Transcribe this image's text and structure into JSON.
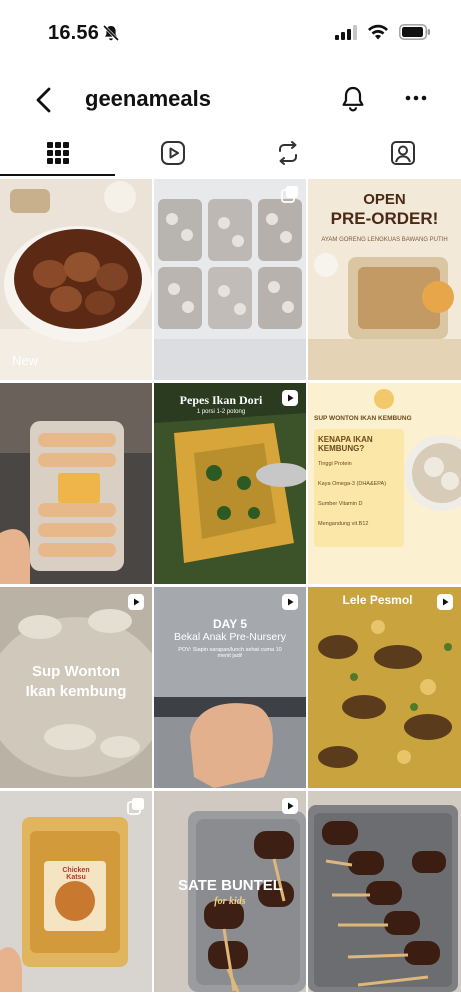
{
  "status": {
    "time": "16.56"
  },
  "profile": {
    "username": "geenameals"
  },
  "tabs": [
    "posts-grid",
    "reels",
    "reposts",
    "tagged"
  ],
  "posts": [
    {
      "overlay": "New",
      "kind": "photo"
    },
    {
      "kind": "carousel"
    },
    {
      "title": "OPEN",
      "subtitle": "PRE-ORDER!",
      "caption": "AYAM GORENG LENGKUAS BAWANG PUTIH",
      "kind": "photo"
    },
    {
      "kind": "photo"
    },
    {
      "title": "Pepes Ikan Dori",
      "caption": "1 porsi 1-2 potong",
      "kind": "reel"
    },
    {
      "title": "SUP WONTON IKAN KEMBUNG",
      "heading": "KENAPA IKAN KEMBUNG?",
      "points": [
        "Tinggi Protein",
        "Kaya Omega-3 (DHA&EPA)",
        "Sumber Vitamin D",
        "Mengandung vit.B12"
      ],
      "kind": "photo"
    },
    {
      "title": "Sup Wonton",
      "subtitle": "Ikan kembung",
      "kind": "reel"
    },
    {
      "title": "DAY 5",
      "subtitle": "Bekal Anak Pre-Nursery",
      "caption": "POV: Siapin sarapan/lunch sehat cuma 10 menit jadi!",
      "kind": "reel"
    },
    {
      "title": "Lele Pesmol",
      "kind": "reel"
    },
    {
      "label": "Chicken Katsu",
      "kind": "carousel"
    },
    {
      "title": "SATE BUNTEL",
      "subtitle": "for kids",
      "kind": "reel"
    },
    {
      "kind": "photo"
    }
  ],
  "colors": {
    "accent": "#111111",
    "background": "#ffffff"
  }
}
